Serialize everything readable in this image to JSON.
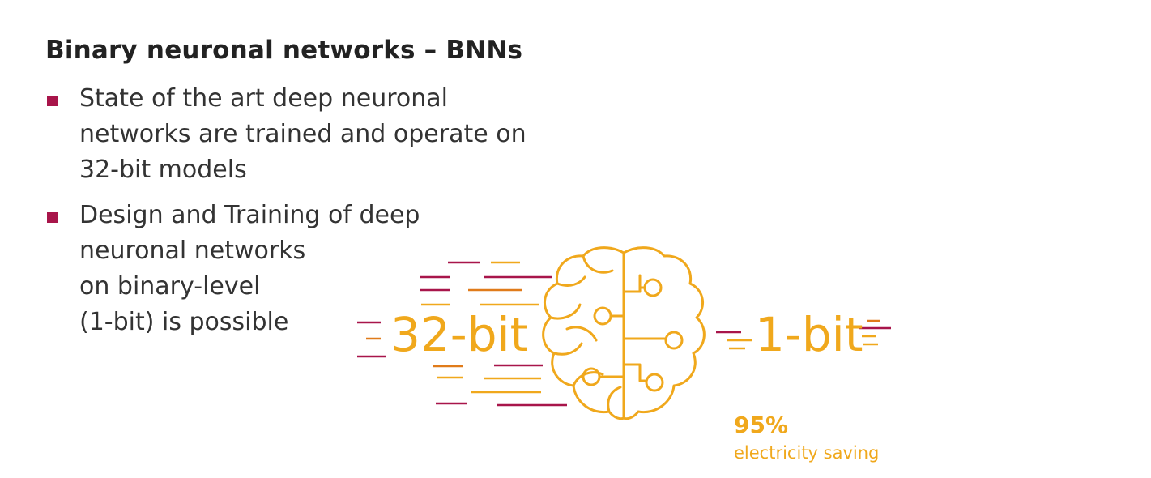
{
  "title": "Binary neuronal networks – BNNs",
  "bullets": [
    {
      "lines": [
        "State of the art deep neuronal",
        "networks are trained and operate on",
        "32-bit models"
      ]
    },
    {
      "lines": [
        "Design and Training of deep",
        "neuronal networks",
        "on binary-level",
        "(1-bit) is possible"
      ]
    }
  ],
  "illustration": {
    "left_label": "32-bit",
    "right_label": "1-bit",
    "stat_value": "95%",
    "stat_caption": "electricity saving",
    "brain_icon": "brain-circuit-icon"
  },
  "colors": {
    "bullet": "#a8154a",
    "accent_yellow": "#f0a81c",
    "accent_orange": "#e07b1a",
    "accent_crimson": "#a8154a",
    "text": "#333333"
  }
}
